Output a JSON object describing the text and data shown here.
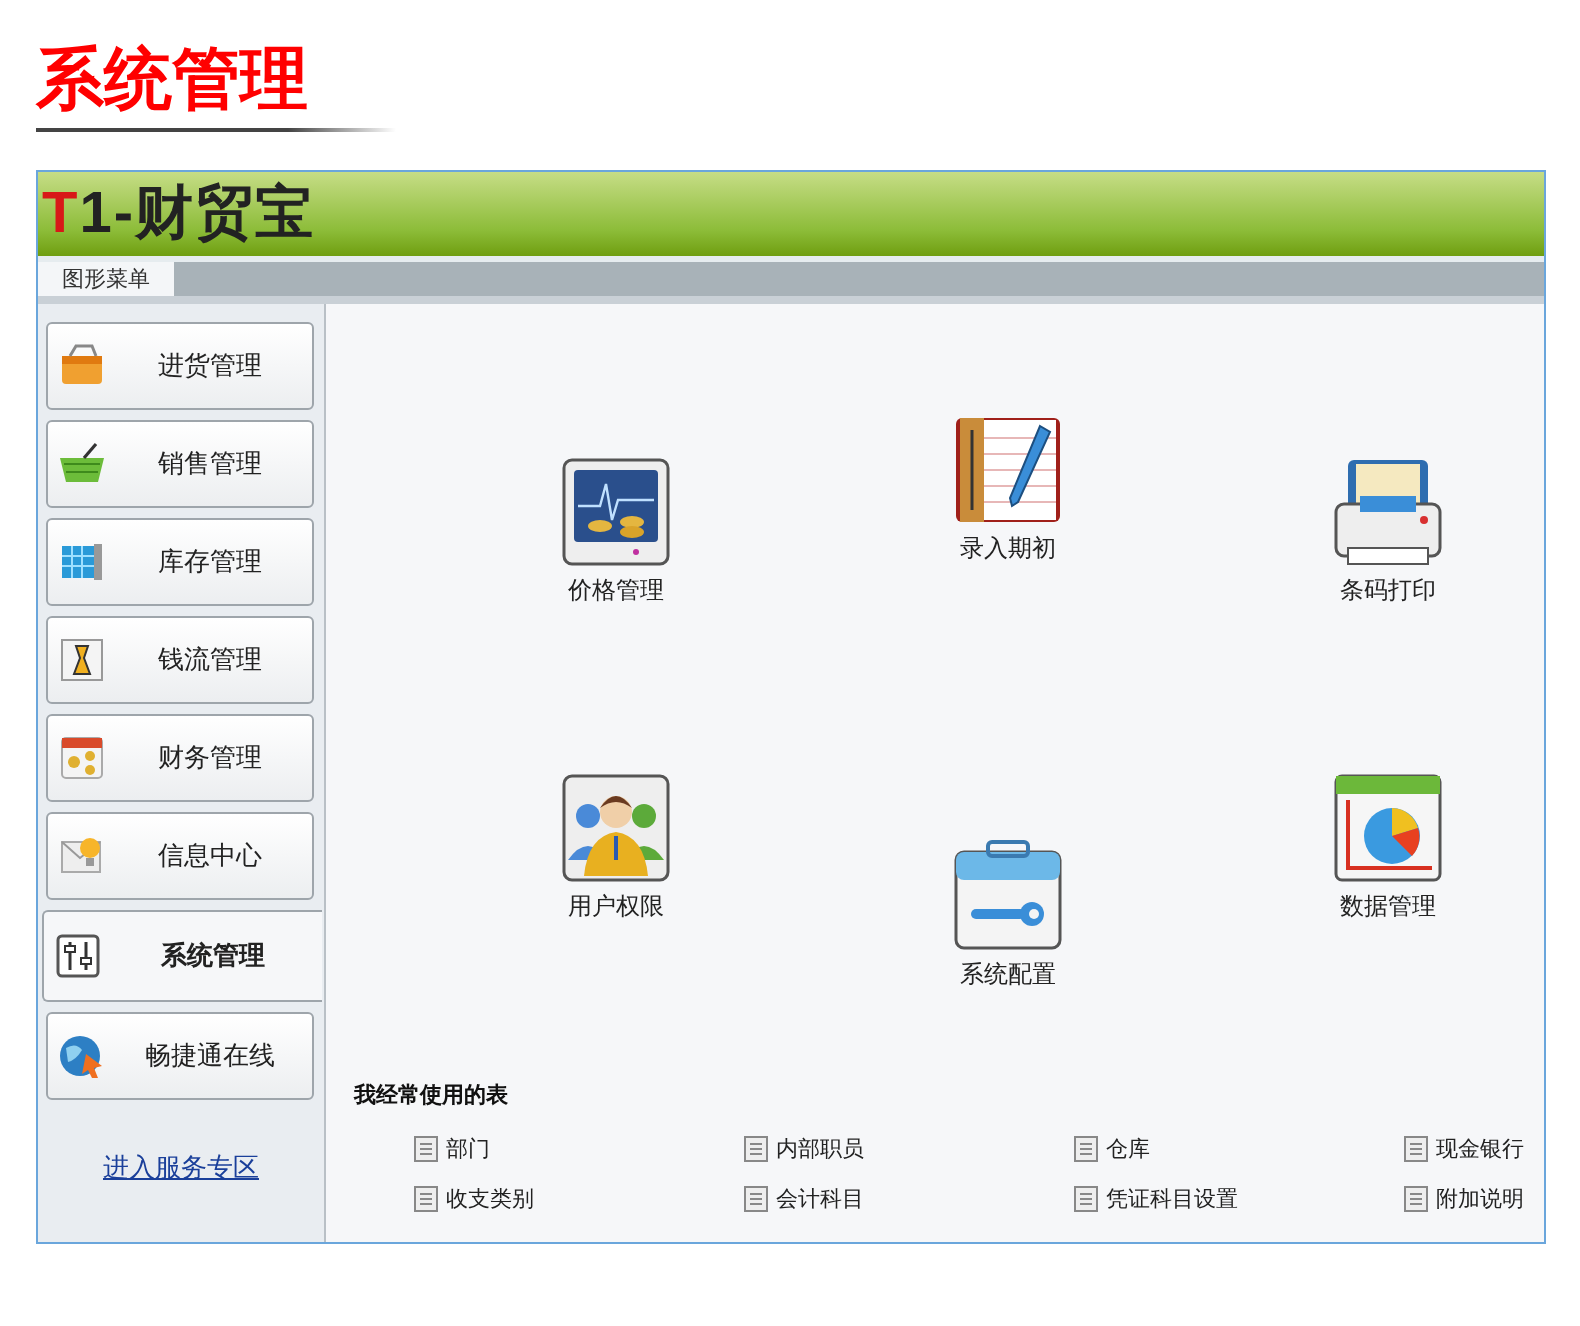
{
  "heading": "系统管理",
  "app": {
    "logo_mark": "T",
    "logo_text": "1-财贸宝"
  },
  "tabs": [
    {
      "label": "图形菜单",
      "selected": true
    }
  ],
  "sidebar": {
    "items": [
      {
        "label": "进货管理",
        "selected": false
      },
      {
        "label": "销售管理",
        "selected": false
      },
      {
        "label": "库存管理",
        "selected": false
      },
      {
        "label": "钱流管理",
        "selected": false
      },
      {
        "label": "财务管理",
        "selected": false
      },
      {
        "label": "信息中心",
        "selected": false
      },
      {
        "label": "系统管理",
        "selected": true
      },
      {
        "label": "畅捷通在线",
        "selected": false
      }
    ],
    "link": "进入服务专区"
  },
  "functions": [
    {
      "label": "价格管理"
    },
    {
      "label": "录入期初"
    },
    {
      "label": "条码打印"
    },
    {
      "label": "用户权限"
    },
    {
      "label": "系统配置"
    },
    {
      "label": "数据管理"
    }
  ],
  "frequent_tables": {
    "title": "我经常使用的表",
    "items": [
      "部门",
      "内部职员",
      "仓库",
      "现金银行",
      "收支类别",
      "会计科目",
      "凭证科目设置",
      "附加说明"
    ]
  }
}
